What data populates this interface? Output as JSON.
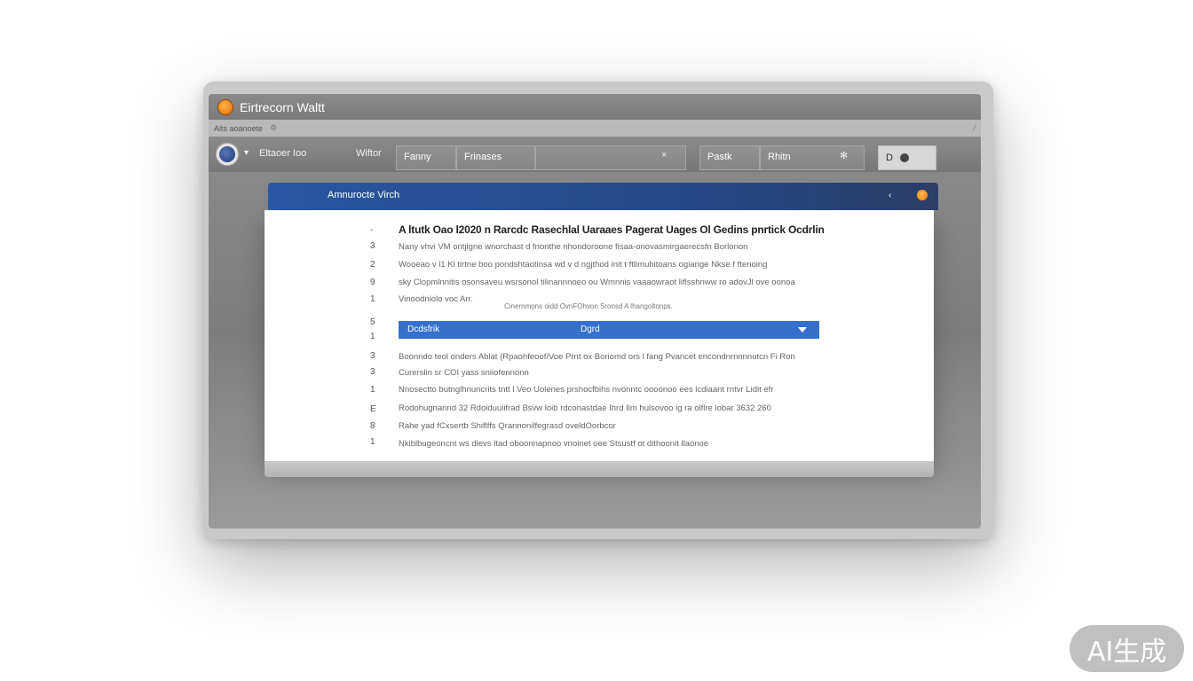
{
  "window": {
    "title": "Eirtrecorn Waltt",
    "menu_label": "Alts aoanoete",
    "menu_icon": "gear-icon"
  },
  "toolbar": {
    "chevron": "▾",
    "label": "Eltaoer Ioo",
    "label2": "Wiftor",
    "field1": "Fanny",
    "field2": "Frinases",
    "field3_clear": "×",
    "field4": "Pastk",
    "field5": "Rhitn",
    "field5_icon": "✻",
    "btn": "D"
  },
  "dialog": {
    "title": "Amnurocte Virch",
    "min_label": "‹",
    "heading": "A ltutk Oao l2020 n Rarcdc Rasechlal Uaraaes Pagerat Uages Ol Gedins pnrtick Ocdrlin",
    "gutter": [
      "-",
      "3",
      "2",
      "9",
      "1",
      "5",
      "1",
      "3",
      "3",
      "1",
      "E",
      "8",
      "1"
    ],
    "lines_top": [
      "Nany vhvi VM ontjigne wnorchast d fnonthe nhondoroone fisaa-onovasmirgaerecsfn Borlonon",
      "Wooeao v l1 Kl tirtne boo pondshtaotinsa wd v d ngjthod init t ftlimuhitoans ogiarige Nkse f ftenoing",
      "sky Clopmlnnitis osonsaveu wsrsonol tilinannnoeo ou Wmnnis vaaaowraot liflsshnww ro adovJl ove oonoa",
      "Vinoodniolo voc Arr."
    ],
    "caption": "Cinernmons oidd OvnFOhvon Sronsd A lhangoltonps.",
    "select": {
      "label": "Dcdsfrik",
      "value": "Dgrd"
    },
    "lines_bottom": [
      "Boonndo teol onders Ablat (Rpaohfeoof/Voe Prnt ox Boriomd ors l fang Pvancet encondnrnnnnutcn Fi Ron",
      "Curerslin sr COI yass sniiofennonn",
      "Nnosectto butnglhnuncrits tntt l Veo Uolenes prshocfbihs nvonntc oooonoo ees lcdiaant rntvr Lidit efr",
      "Rodohugnannd 32 Rdoiduuiifrad Bsvw loib rdconastdae Ihrd Ilm hulsovoo ig ra olflre lobar 3632 260",
      "Rahe yad fCxsertb Shiflffs Qrannonilfegrasd oveldOorbcor",
      "Nkiblbugeoncnt ws dlevs ltad oboonnapnoo vnoinet oee  Stsustf ot dithoonit llaonoe"
    ]
  },
  "watermark": "AI生成"
}
